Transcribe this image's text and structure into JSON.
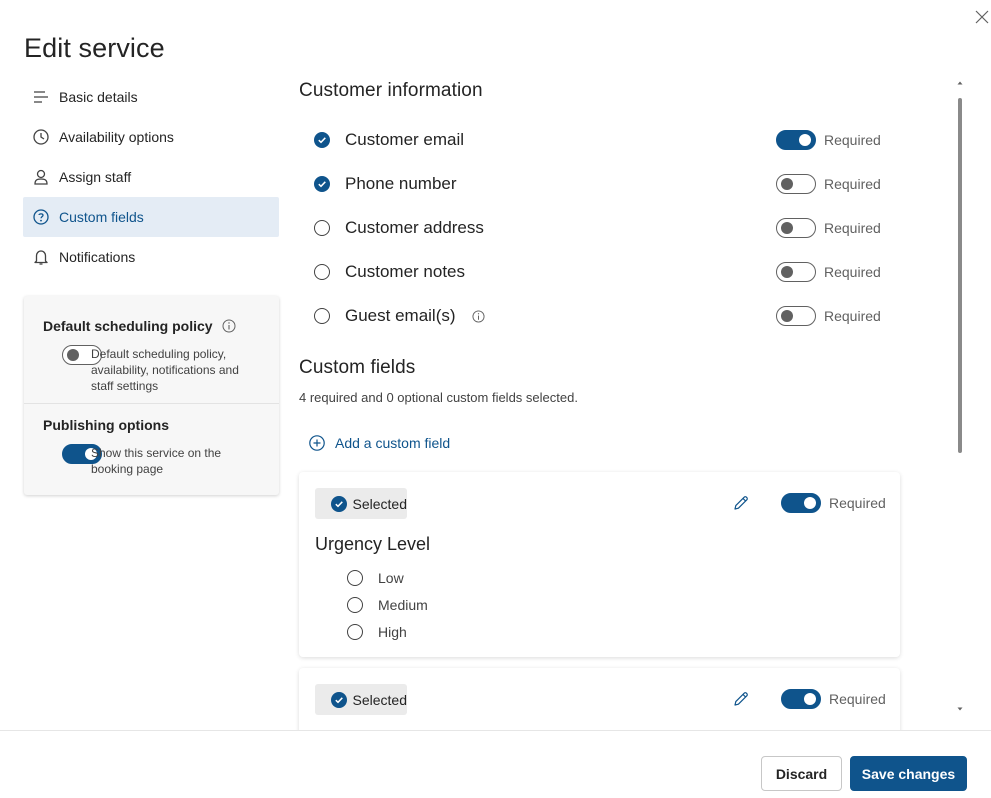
{
  "dialog": {
    "title": "Edit service",
    "close_icon": "close-icon"
  },
  "sidebar": {
    "items": [
      {
        "label": "Basic details",
        "icon": "list-icon",
        "active": false
      },
      {
        "label": "Availability options",
        "icon": "clock-icon",
        "active": false
      },
      {
        "label": "Assign staff",
        "icon": "person-icon",
        "active": false
      },
      {
        "label": "Custom fields",
        "icon": "question-circle-icon",
        "active": true
      },
      {
        "label": "Notifications",
        "icon": "bell-icon",
        "active": false
      }
    ],
    "policy": {
      "heading": "Default scheduling policy",
      "toggle_on": false,
      "description": "Default scheduling policy, availability, notifications and staff settings"
    },
    "publishing": {
      "heading": "Publishing options",
      "toggle_on": true,
      "description": "Show this service on the booking page"
    }
  },
  "customer_info": {
    "title": "Customer information",
    "fields": [
      {
        "label": "Customer email",
        "checked": true,
        "required": true,
        "required_label": "Required"
      },
      {
        "label": "Phone number",
        "checked": true,
        "required": false,
        "required_label": "Required"
      },
      {
        "label": "Customer address",
        "checked": false,
        "required": false,
        "required_label": "Required"
      },
      {
        "label": "Customer notes",
        "checked": false,
        "required": false,
        "required_label": "Required"
      },
      {
        "label": "Guest email(s)",
        "checked": false,
        "required": false,
        "required_label": "Required",
        "has_info": true
      }
    ]
  },
  "custom_fields": {
    "title": "Custom fields",
    "summary": "4 required and 0 optional custom fields selected.",
    "add_label": "Add a custom field",
    "cards": [
      {
        "selected_label": "Selected",
        "required_label": "Required",
        "required": true,
        "name": "Urgency Level",
        "options": [
          "Low",
          "Medium",
          "High"
        ]
      },
      {
        "selected_label": "Selected",
        "required_label": "Required",
        "required": true
      }
    ]
  },
  "footer": {
    "discard_label": "Discard",
    "save_label": "Save changes"
  },
  "colors": {
    "accent": "#0f548c",
    "active_nav_bg": "#e4ecf5"
  }
}
